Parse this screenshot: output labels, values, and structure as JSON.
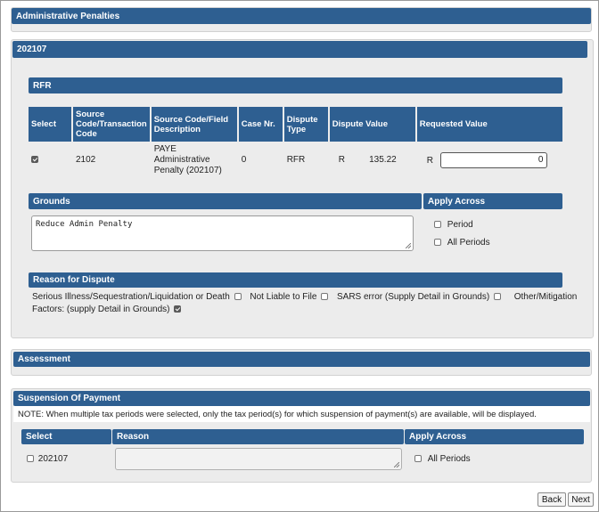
{
  "admin_penalties": {
    "title": "Administrative Penalties"
  },
  "period_section": {
    "title": "202107"
  },
  "rfr": {
    "title": "RFR",
    "headers": [
      "Select",
      "Source Code/Transaction Code",
      "Source Code/Field Description",
      "Case Nr.",
      "Dispute Type",
      "Dispute Value",
      "Requested Value"
    ],
    "row": {
      "selected": true,
      "source_code": "2102",
      "description": "PAYE Administrative Penalty (202107)",
      "case_nr": "0",
      "dispute_type": "RFR",
      "currency": "R",
      "dispute_value": "135.22",
      "requested_currency": "R",
      "requested_value": "0"
    }
  },
  "grounds": {
    "title": "Grounds",
    "text": "Reduce Admin Penalty"
  },
  "apply_across": {
    "title": "Apply Across",
    "period_label": "Period",
    "period_checked": false,
    "all_periods_label": "All Periods",
    "all_periods_checked": false
  },
  "reason": {
    "title": "Reason for Dispute",
    "options": [
      {
        "label": "Serious Illness/Sequestration/Liquidation or Death",
        "checked": false
      },
      {
        "label": "Not Liable to File",
        "checked": false
      },
      {
        "label": "SARS error (Supply Detail in Grounds)",
        "checked": false
      },
      {
        "label": "Other/Mitigation Factors: (supply Detail in Grounds)",
        "checked": true
      }
    ],
    "line1_part": "Other/Mitigation",
    "line2_part": "Factors: (supply Detail in Grounds)"
  },
  "assessment": {
    "title": "Assessment"
  },
  "suspension": {
    "title": "Suspension Of Payment",
    "note": "NOTE: When multiple tax periods were selected, only the tax period(s) for which suspension of payment(s) are available, will be displayed.",
    "headers": [
      "Select",
      "Reason",
      "Apply Across"
    ],
    "row": {
      "period": "202107",
      "checked": false,
      "all_periods_label": "All Periods",
      "all_periods_checked": false
    }
  },
  "buttons": {
    "back": "Back",
    "next": "Next"
  }
}
